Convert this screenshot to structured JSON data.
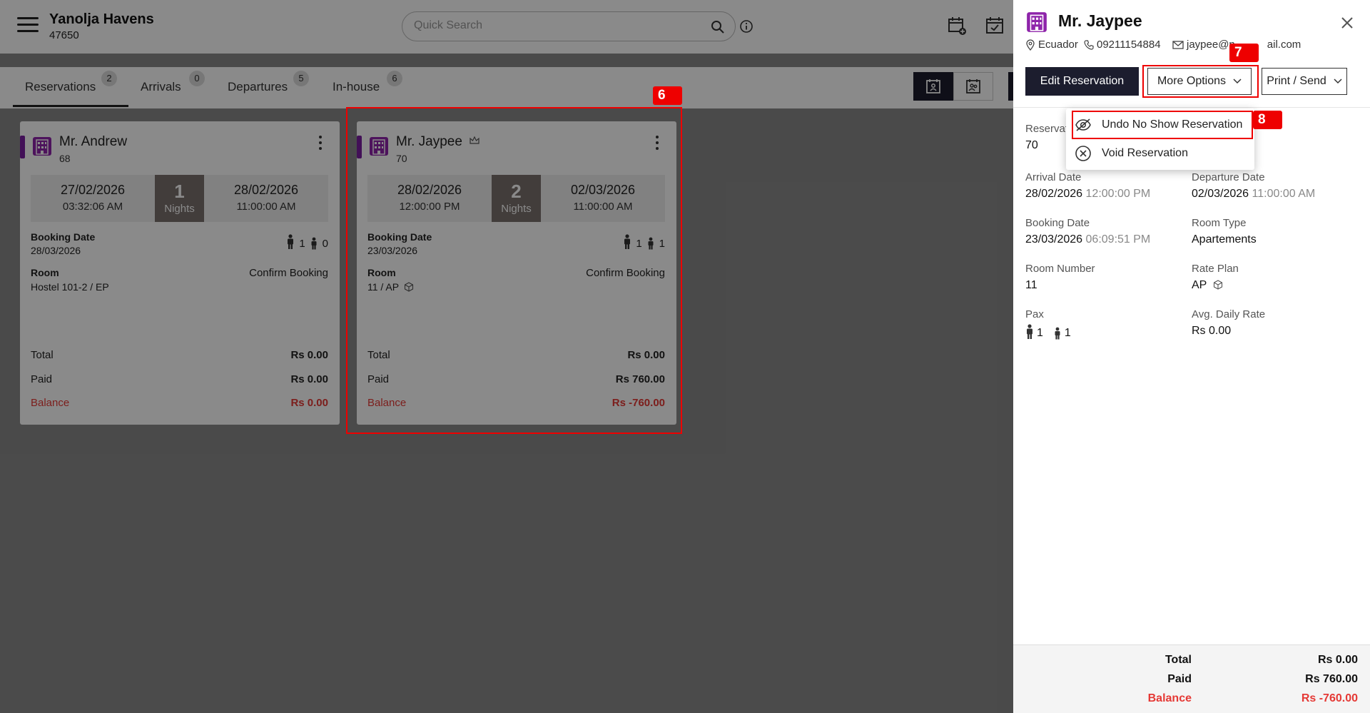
{
  "header": {
    "property_name": "Yanolja Havens",
    "property_id": "47650",
    "search_placeholder": "Quick Search"
  },
  "tabs": [
    {
      "label": "Reservations",
      "count": "2"
    },
    {
      "label": "Arrivals",
      "count": "0"
    },
    {
      "label": "Departures",
      "count": "5"
    },
    {
      "label": "In-house",
      "count": "6"
    }
  ],
  "cards": [
    {
      "guest": "Mr. Andrew",
      "res_no": "68",
      "checkin_date": "27/02/2026",
      "checkin_time": "03:32:06 AM",
      "nights": "1",
      "nights_label": "Nights",
      "checkout_date": "28/02/2026",
      "checkout_time": "11:00:00 AM",
      "booking_date_label": "Booking Date",
      "booking_date": "28/03/2026",
      "adults": "1",
      "children": "0",
      "room_label": "Room",
      "room": "Hostel 101-2 / EP",
      "status": "Confirm Booking",
      "total_label": "Total",
      "total": "Rs 0.00",
      "paid_label": "Paid",
      "paid": "Rs 0.00",
      "balance_label": "Balance",
      "balance": "Rs 0.00"
    },
    {
      "guest": "Mr. Jaypee",
      "res_no": "70",
      "checkin_date": "28/02/2026",
      "checkin_time": "12:00:00 PM",
      "nights": "2",
      "nights_label": "Nights",
      "checkout_date": "02/03/2026",
      "checkout_time": "11:00:00 AM",
      "booking_date_label": "Booking Date",
      "booking_date": "23/03/2026",
      "adults": "1",
      "children": "1",
      "room_label": "Room",
      "room": "11 / AP",
      "status": "Confirm Booking",
      "total_label": "Total",
      "total": "Rs 0.00",
      "paid_label": "Paid",
      "paid": "Rs 760.00",
      "balance_label": "Balance",
      "balance": "Rs -760.00"
    }
  ],
  "annotations": {
    "six": "6",
    "seven": "7",
    "eight": "8"
  },
  "panel": {
    "guest": "Mr. Jaypee",
    "country": "Ecuador",
    "phone": "09211154884",
    "email": "jaypee@n",
    "email_tail": "ail.com",
    "edit_label": "Edit Reservation",
    "more_label": "More Options",
    "print_label": "Print / Send",
    "dropdown": [
      {
        "label": "Undo No Show Reservation",
        "icon": "eye-slash-icon"
      },
      {
        "label": "Void Reservation",
        "icon": "circle-x-icon"
      }
    ],
    "fields": {
      "res_label": "Reservat",
      "res_value": "70",
      "arrival_label": "Arrival Date",
      "arrival_date": "28/02/2026",
      "arrival_time": "12:00:00 PM",
      "departure_label": "Departure Date",
      "departure_date": "02/03/2026",
      "departure_time": "11:00:00 AM",
      "booking_label": "Booking Date",
      "booking_date": "23/03/2026",
      "booking_time": "06:09:51 PM",
      "room_type_label": "Room Type",
      "room_type": "Apartements",
      "room_number_label": "Room Number",
      "room_number": "11",
      "rate_plan_label": "Rate Plan",
      "rate_plan": "AP",
      "pax_label": "Pax",
      "adults": "1",
      "children": "1",
      "adr_label": "Avg. Daily Rate",
      "adr": "Rs 0.00"
    },
    "totals": {
      "total_label": "Total",
      "total": "Rs 0.00",
      "paid_label": "Paid",
      "paid": "Rs 760.00",
      "balance_label": "Balance",
      "balance": "Rs -760.00"
    }
  },
  "colors": {
    "accent": "#7b1fa2",
    "dark": "#1c1d2e",
    "balance": "#e53935",
    "annotation": "#ee0000"
  }
}
